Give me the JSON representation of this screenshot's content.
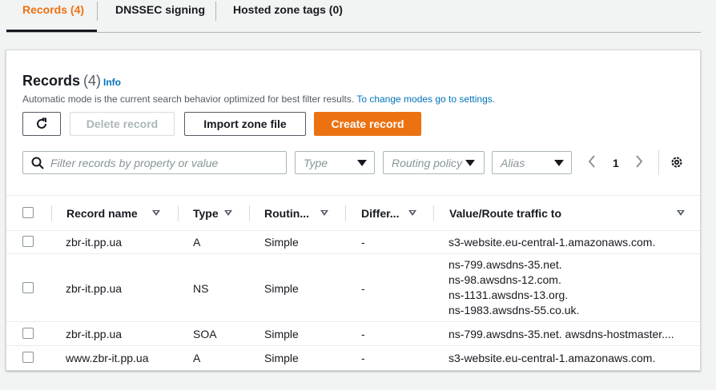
{
  "tabs": [
    {
      "label": "Records (4)",
      "active": true
    },
    {
      "label": "DNSSEC signing",
      "active": false
    },
    {
      "label": "Hosted zone tags (0)",
      "active": false
    }
  ],
  "records_panel": {
    "title": "Records",
    "count": "(4)",
    "info": "Info",
    "description": "Automatic mode is the current search behavior optimized for best filter results.",
    "settings_link": "To change modes go to settings."
  },
  "buttons": {
    "refresh_icon": "refresh-icon",
    "delete": "Delete record",
    "import": "Import zone file",
    "create": "Create record"
  },
  "filters": {
    "search_placeholder": "Filter records by property or value",
    "type": "Type",
    "routing": "Routing policy",
    "alias": "Alias"
  },
  "pagination": {
    "page": "1"
  },
  "columns": [
    "Record name",
    "Type",
    "Routin...",
    "Differ...",
    "Value/Route traffic to"
  ],
  "rows": [
    {
      "name": "zbr-it.pp.ua",
      "type": "A",
      "routing": "Simple",
      "differ": "-",
      "values": [
        "s3-website.eu-central-1.amazonaws.com."
      ]
    },
    {
      "name": "zbr-it.pp.ua",
      "type": "NS",
      "routing": "Simple",
      "differ": "-",
      "values": [
        "ns-799.awsdns-35.net.",
        "ns-98.awsdns-12.com.",
        "ns-1131.awsdns-13.org.",
        "ns-1983.awsdns-55.co.uk."
      ]
    },
    {
      "name": "zbr-it.pp.ua",
      "type": "SOA",
      "routing": "Simple",
      "differ": "-",
      "values": [
        "ns-799.awsdns-35.net. awsdns-hostmaster...."
      ]
    },
    {
      "name": "www.zbr-it.pp.ua",
      "type": "A",
      "routing": "Simple",
      "differ": "-",
      "values": [
        "s3-website.eu-central-1.amazonaws.com."
      ]
    }
  ],
  "colors": {
    "accent": "#ec7211",
    "link": "#0073bb",
    "text": "#16191f",
    "muted": "#545b64"
  }
}
